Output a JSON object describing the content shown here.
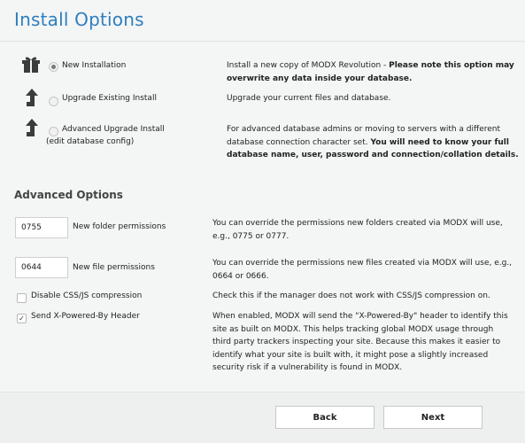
{
  "page": {
    "title": "Install Options"
  },
  "install_options": [
    {
      "label": "New Installation",
      "icon": "gift-icon",
      "selected": true,
      "desc_plain": "Install a new copy of MODX Revolution - ",
      "desc_bold": "Please note this option may overwrite any data inside your database."
    },
    {
      "label": "Upgrade Existing Install",
      "icon": "upgrade-arrow-icon",
      "selected": false,
      "desc_plain": "Upgrade your current files and database.",
      "desc_bold": ""
    },
    {
      "label": "Advanced Upgrade Install",
      "sublabel": "(edit database config)",
      "icon": "upgrade-arrow-icon",
      "selected": false,
      "desc_plain": "For advanced database admins or moving to servers with a different database connection character set. ",
      "desc_bold": "You will need to know your full database name, user, password and connection/collation details."
    }
  ],
  "advanced": {
    "title": "Advanced Options",
    "folder_permissions": {
      "value": "0755",
      "label": "New folder permissions",
      "desc": "You can override the permissions new folders created via MODX will use, e.g., 0775 or 0777."
    },
    "file_permissions": {
      "value": "0644",
      "label": "New file permissions",
      "desc": "You can override the permissions new files created via MODX will use, e.g., 0664 or 0666."
    },
    "disable_compression": {
      "label": "Disable CSS/JS compression",
      "checked": false,
      "desc": "Check this if the manager does not work with CSS/JS compression on."
    },
    "powered_by": {
      "label": "Send X-Powered-By Header",
      "checked": true,
      "desc": "When enabled, MODX will send the \"X-Powered-By\" header to identify this site as built on MODX. This helps tracking global MODX usage through third party trackers inspecting your site. Because this makes it easier to identify what your site is built with, it might pose a slightly increased security risk if a vulnerability is found in MODX."
    }
  },
  "buttons": {
    "back": "Back",
    "next": "Next"
  },
  "colors": {
    "title": "#2d7fbf",
    "background": "#f4f5f5"
  }
}
